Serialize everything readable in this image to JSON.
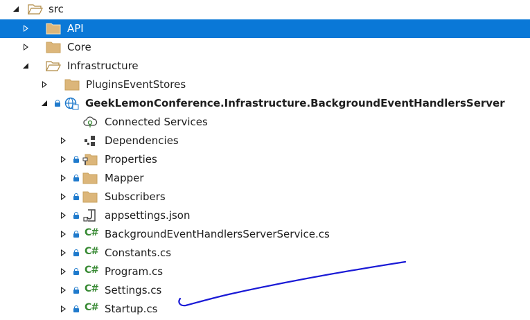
{
  "colors": {
    "selection": "#0a78d7",
    "folder": "#dcb67a",
    "folder_outline": "#b08a45",
    "lock": "#1f7acc",
    "csharp": "#388a34",
    "annotation": "#1a1ad6"
  },
  "tree": {
    "src": {
      "label": "src",
      "icon": "folder-open-icon",
      "expanded": true
    },
    "api": {
      "label": "API",
      "icon": "folder-icon",
      "selected": true
    },
    "core": {
      "label": "Core",
      "icon": "folder-icon"
    },
    "infrastructure": {
      "label": "Infrastructure",
      "icon": "folder-open-icon",
      "expanded": true
    },
    "plugins": {
      "label": "PluginsEventStores",
      "icon": "folder-icon"
    },
    "project": {
      "label": "GeekLemonConference.Infrastructure.BackgroundEventHandlersServer",
      "icon": "web-project-icon",
      "expanded": true
    },
    "connected_services": {
      "label": "Connected Services",
      "icon": "connected-services-icon"
    },
    "dependencies": {
      "label": "Dependencies",
      "icon": "dependencies-icon"
    },
    "properties": {
      "label": "Properties",
      "icon": "properties-folder-icon"
    },
    "mapper": {
      "label": "Mapper",
      "icon": "folder-icon"
    },
    "subscribers": {
      "label": "Subscribers",
      "icon": "folder-icon"
    },
    "appsettings": {
      "label": "appsettings.json",
      "icon": "json-file-icon"
    },
    "files": [
      {
        "label": "BackgroundEventHandlersServerService.cs",
        "icon": "csharp-file-icon"
      },
      {
        "label": "Constants.cs",
        "icon": "csharp-file-icon"
      },
      {
        "label": "Program.cs",
        "icon": "csharp-file-icon"
      },
      {
        "label": "Settings.cs",
        "icon": "csharp-file-icon"
      },
      {
        "label": "Startup.cs",
        "icon": "csharp-file-icon"
      }
    ],
    "csharp_glyph": "C#"
  }
}
